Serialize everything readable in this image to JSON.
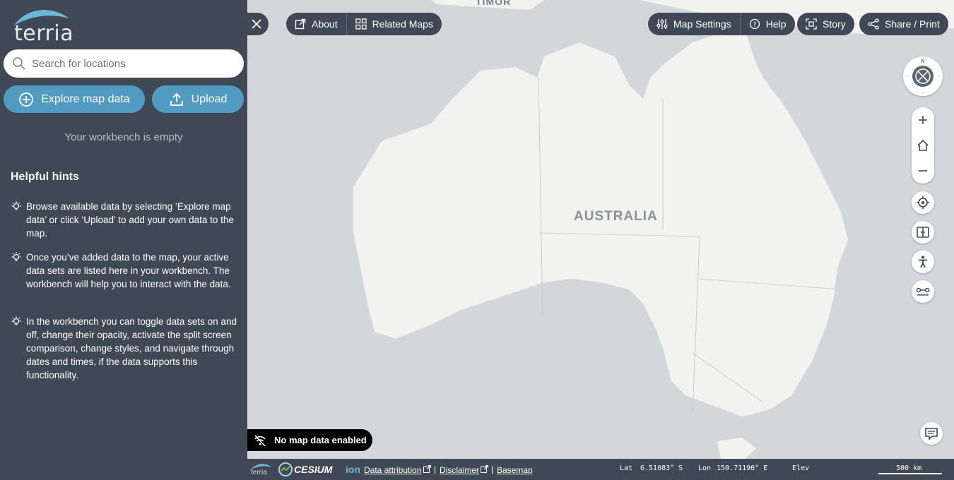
{
  "sidebar": {
    "logo_text": "terria",
    "search_placeholder": "Search for locations",
    "explore_label": "Explore map data",
    "upload_label": "Upload",
    "empty_text": "Your workbench is empty",
    "hints_title": "Helpful hints",
    "hints": [
      "Browse available data by selecting ‘Explore map data’ or click ‘Upload’ to add your own data to the map.",
      "Once you’ve added data to the map, your active data sets are listed here in your workbench. The workbench will help you to interact with the data.",
      "In the workbench you can toggle data sets on and off, change their opacity, activate the split screen comparison, change styles, and navigate through dates and times, if the data supports this functionality."
    ]
  },
  "toolbar": {
    "about": "About",
    "related_maps": "Related Maps",
    "map_settings": "Map Settings",
    "help": "Help",
    "story": "Story",
    "share": "Share / Print"
  },
  "map": {
    "country_label": "AUSTRALIA",
    "timor_label": "TIMOR",
    "status_text": "No map data enabled",
    "compass_letter": "N"
  },
  "bottom": {
    "cesium": "CESIUM",
    "ion": "ion",
    "attribution": "Data attribution",
    "disclaimer": "Disclaimer",
    "basemap": "Basemap",
    "sep": "|",
    "lat_label": "Lat",
    "lat_value": "6.51083° S",
    "lon_label": "Lon",
    "lon_value": "150.71190° E",
    "elev_label": "Elev",
    "scale_label": "500 km",
    "terria_small": "terria"
  },
  "colors": {
    "sidebar_bg": "#3f4854",
    "accent": "#519ac2",
    "map_sea": "#d3d7da",
    "map_land": "#f2f2f1"
  }
}
